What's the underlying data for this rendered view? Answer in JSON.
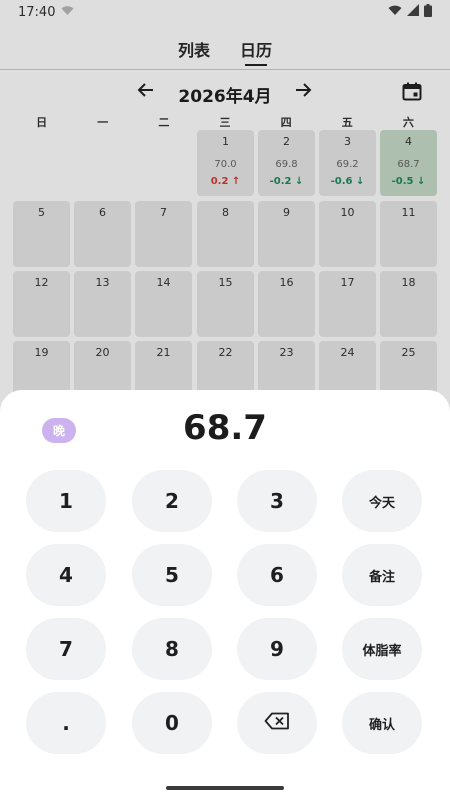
{
  "status": {
    "time": "17:40"
  },
  "tabs": [
    {
      "label": "列表"
    },
    {
      "label": "日历"
    }
  ],
  "calendar": {
    "month_title": "2026年4月",
    "weekdays": [
      "日",
      "一",
      "二",
      "三",
      "四",
      "五",
      "六"
    ],
    "days": [
      {
        "day": "1",
        "weight": "70.0",
        "delta": "0.2 ↑",
        "dir": "up"
      },
      {
        "day": "2",
        "weight": "69.8",
        "delta": "-0.2 ↓",
        "dir": "down"
      },
      {
        "day": "3",
        "weight": "69.2",
        "delta": "-0.6 ↓",
        "dir": "down"
      },
      {
        "day": "4",
        "weight": "68.7",
        "delta": "-0.5 ↓",
        "dir": "down"
      },
      {
        "day": "5"
      },
      {
        "day": "6"
      },
      {
        "day": "7"
      },
      {
        "day": "8"
      },
      {
        "day": "9"
      },
      {
        "day": "10"
      },
      {
        "day": "11"
      },
      {
        "day": "12"
      },
      {
        "day": "13"
      },
      {
        "day": "14"
      },
      {
        "day": "15"
      },
      {
        "day": "16"
      },
      {
        "day": "17"
      },
      {
        "day": "18"
      },
      {
        "day": "19"
      },
      {
        "day": "20"
      },
      {
        "day": "21"
      },
      {
        "day": "22"
      },
      {
        "day": "23"
      },
      {
        "day": "24"
      },
      {
        "day": "25"
      }
    ]
  },
  "sheet": {
    "period_label": "晚",
    "value": "68.7",
    "keys": {
      "k1": "1",
      "k2": "2",
      "k3": "3",
      "today": "今天",
      "k4": "4",
      "k5": "5",
      "k6": "6",
      "note": "备注",
      "k7": "7",
      "k8": "8",
      "k9": "9",
      "bodyfat": "体脂率",
      "dot": ".",
      "k0": "0",
      "confirm": "确认"
    }
  },
  "colors": {
    "accent_purple": "#ccb3ef",
    "up_red": "#d63b2f",
    "down_green": "#1e8a5c",
    "selected_day": "#c7dcc9"
  }
}
